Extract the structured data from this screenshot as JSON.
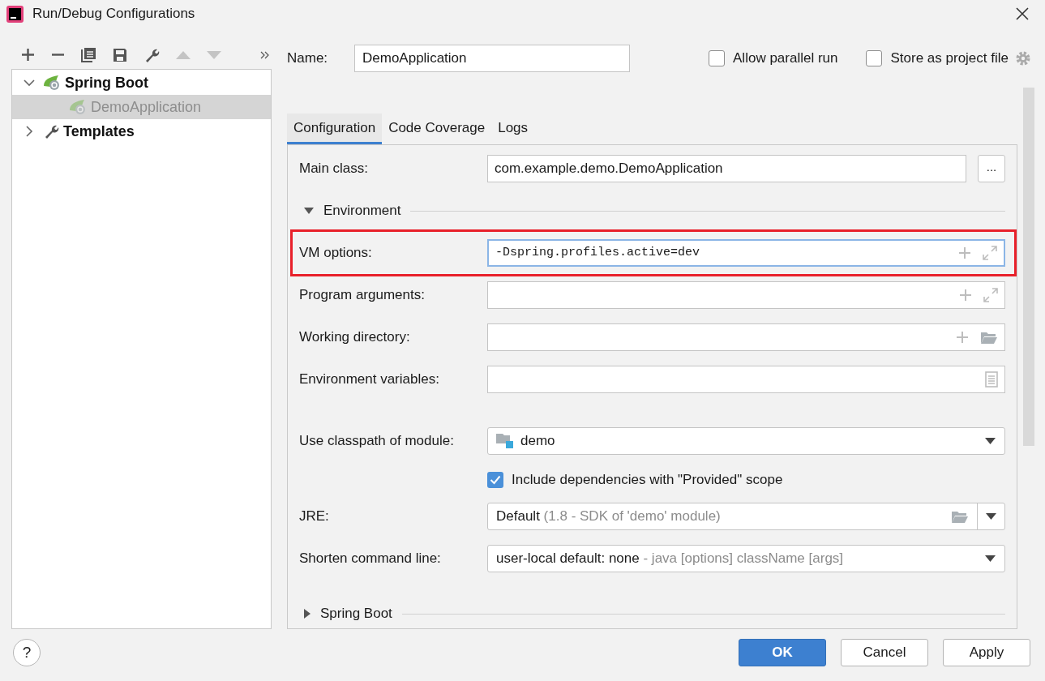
{
  "window": {
    "title": "Run/Debug Configurations"
  },
  "tree": [
    {
      "kind": "group",
      "label": "Spring Boot",
      "expanded": true,
      "selected": false,
      "dimmed": false,
      "children": [
        {
          "kind": "config",
          "label": "DemoApplication",
          "selected": true,
          "dimmed": true
        }
      ]
    },
    {
      "kind": "group",
      "label": "Templates",
      "expanded": false,
      "selected": false,
      "dimmed": false
    }
  ],
  "name_field": {
    "label": "Name:",
    "value": "DemoApplication"
  },
  "options": [
    {
      "label": "Allow parallel run",
      "checked": false
    },
    {
      "label": "Store as project file",
      "checked": false
    }
  ],
  "tabs": [
    {
      "label": "Configuration",
      "selected": true
    },
    {
      "label": "Code Coverage",
      "selected": false
    },
    {
      "label": "Logs",
      "selected": false
    }
  ],
  "rows": [
    {
      "kind": "class_field",
      "label": "Main class:",
      "value": "com.example.demo.DemoApplication",
      "button": "...",
      "highlighted": false,
      "focused": false
    },
    {
      "kind": "section",
      "label": "Environment",
      "expanded": true
    },
    {
      "kind": "expand_field",
      "label": "VM options:",
      "value": "-Dspring.profiles.active=dev",
      "highlighted": true,
      "focused": true
    },
    {
      "kind": "expand_field",
      "label": "Program arguments:",
      "highlighted": false,
      "focused": false
    },
    {
      "kind": "dir_field",
      "label": "Working directory:",
      "highlighted": false,
      "focused": false
    },
    {
      "kind": "env_field",
      "label": "Environment variables:",
      "highlighted": false,
      "focused": false
    },
    {
      "kind": "module_select",
      "label": "Use classpath of module:",
      "value": "demo"
    },
    {
      "kind": "checkbox",
      "label": "Include dependencies with \"Provided\" scope",
      "checked": true
    },
    {
      "kind": "jre_select",
      "label": "JRE:",
      "value": "Default",
      "hint": "(1.8 - SDK of 'demo' module)"
    },
    {
      "kind": "select",
      "label": "Shorten command line:",
      "value": "user-local default: none",
      "hint": "- java [options] className [args]"
    },
    {
      "kind": "section",
      "label": "Spring Boot",
      "expanded": false
    }
  ],
  "help": "?",
  "buttons": [
    {
      "label": "OK",
      "kind": "primary"
    },
    {
      "label": "Cancel",
      "kind": "normal"
    },
    {
      "label": "Apply",
      "kind": "normal"
    }
  ]
}
